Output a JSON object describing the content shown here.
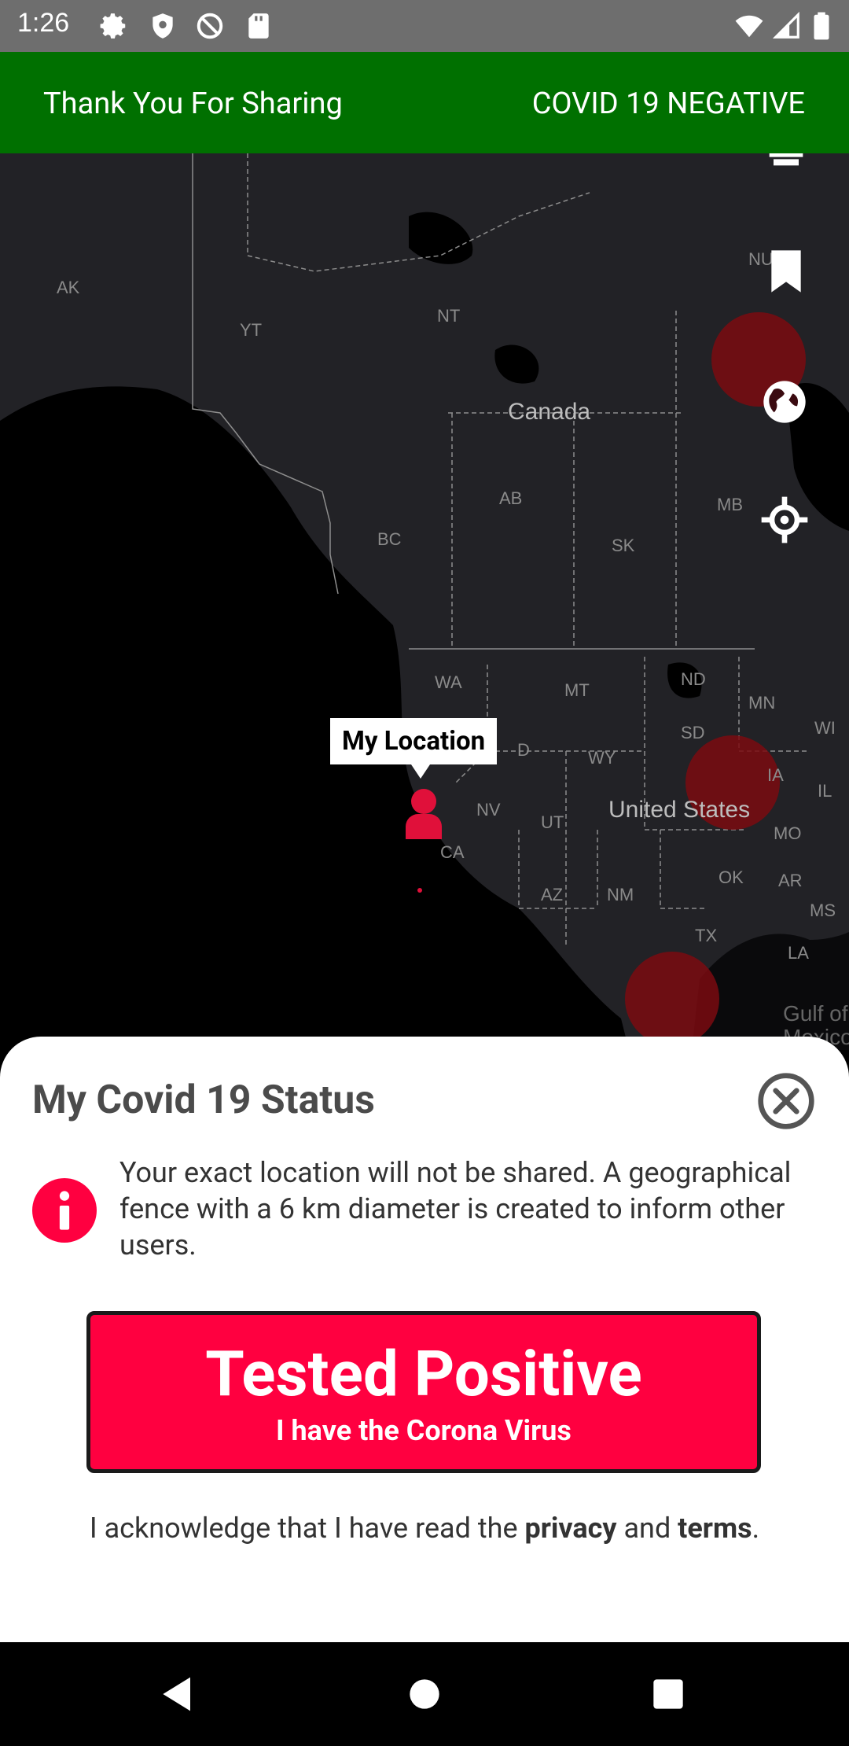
{
  "status_bar": {
    "time": "1:26"
  },
  "banner": {
    "left_text": "Thank You For Sharing",
    "right_text": "COVID 19 NEGATIVE"
  },
  "map": {
    "labels": {
      "ak": "AK",
      "yt": "YT",
      "nt": "NT",
      "nu": "NU",
      "canada": "Canada",
      "ab": "AB",
      "bc": "BC",
      "sk": "SK",
      "mb": "MB",
      "wa": "WA",
      "mt": "MT",
      "nd": "ND",
      "mn": "MN",
      "sd": "SD",
      "wi": "WI",
      "id": "D",
      "wy": "WY",
      "ia": "IA",
      "il": "IL",
      "nv": "NV",
      "ut": "UT",
      "us": "United States",
      "mo": "MO",
      "ca": "CA",
      "ok": "OK",
      "ar": "AR",
      "az": "AZ",
      "nm": "NM",
      "ms": "MS",
      "tx": "TX",
      "la": "LA",
      "gulf": "Gulf of",
      "mexico": "Mexico"
    },
    "callout": "My Location",
    "colors": {
      "hotspot": "#7a0a10",
      "marker": "#e0103a",
      "land": "#222226",
      "water": "#000000"
    }
  },
  "sheet": {
    "title": "My Covid 19 Status",
    "info_text": "Your exact location will not be shared. A geographical fence with a 6 km diameter is created to inform other users.",
    "button_main": "Tested Positive",
    "button_sub": "I have the Corona Virus",
    "ack_prefix": "I acknowledge that I have read the ",
    "ack_privacy": "privacy",
    "ack_and": " and ",
    "ack_terms": "terms",
    "ack_suffix": ".",
    "accent_color": "#ff0040"
  },
  "icons": [
    "gear-icon",
    "shield-icon",
    "at-icon",
    "sd-card-icon",
    "wifi-icon",
    "signal-icon",
    "battery-icon",
    "bookmark-icon",
    "globe-icon",
    "crosshair-icon",
    "close-icon",
    "info-icon",
    "back-icon",
    "home-icon",
    "recents-icon"
  ]
}
